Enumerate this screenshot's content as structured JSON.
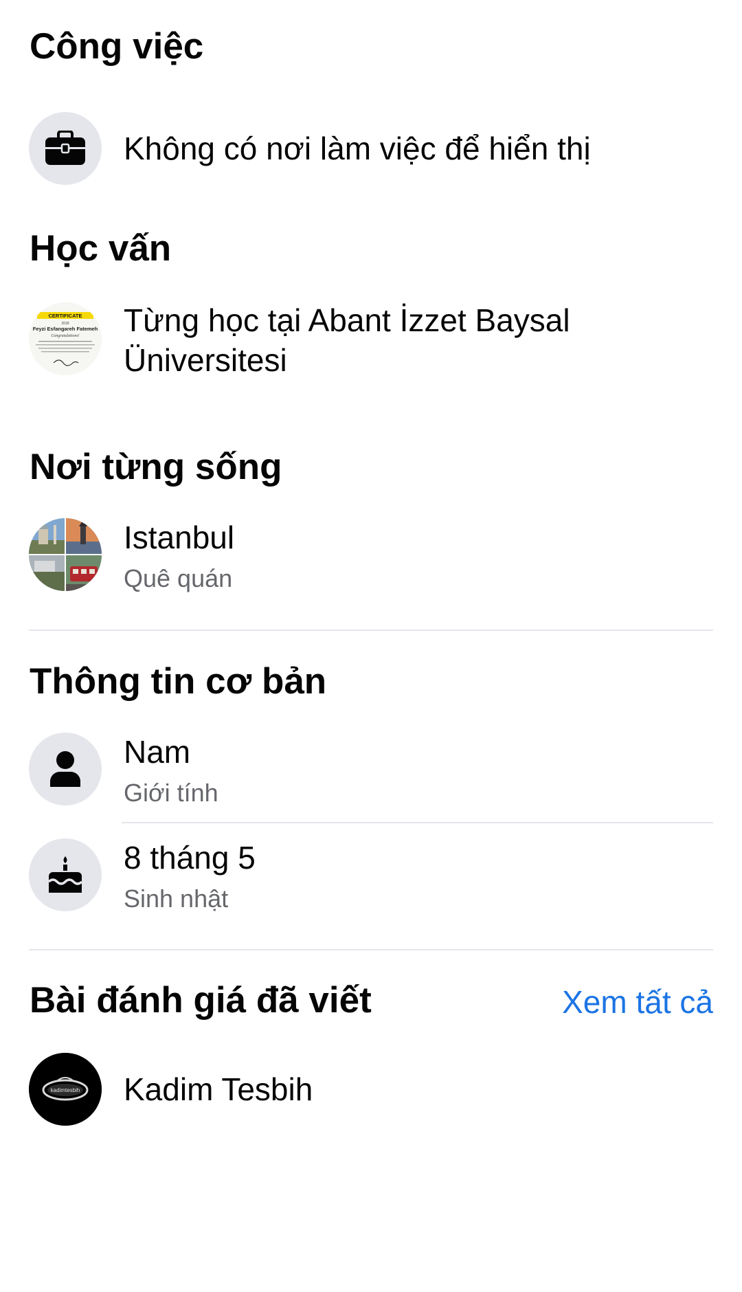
{
  "work": {
    "title": "Công việc",
    "icon": "briefcase-icon",
    "empty_text": "Không có nơi làm việc để hiển thị"
  },
  "education": {
    "title": "Học vấn",
    "line1": "Từng học tại Abant İzzet Baysal",
    "line2": "Üniversitesi",
    "thumbnail": {
      "banner": "CERTIFICATE",
      "year": "2018",
      "name": "Feyzi Esfangareh Fatemeh",
      "greeting": "Congratulations!"
    }
  },
  "places": {
    "title": "Nơi từng sống",
    "name": "Istanbul",
    "label": "Quê quán"
  },
  "basic_info": {
    "title": "Thông tin cơ bản",
    "gender_value": "Nam",
    "gender_label": "Giới tính",
    "birthday_value": "8 tháng 5",
    "birthday_label": "Sinh nhật"
  },
  "reviews": {
    "title": "Bài đánh giá đã viết",
    "see_all": "Xem tất cả",
    "item_name": "Kadim Tesbih",
    "logo_text": "kadimtesbih"
  },
  "colors": {
    "text_primary": "#050505",
    "text_secondary": "#65676b",
    "link": "#1b74e4",
    "icon_bg": "#e4e6eb",
    "divider": "#e4e6eb"
  }
}
